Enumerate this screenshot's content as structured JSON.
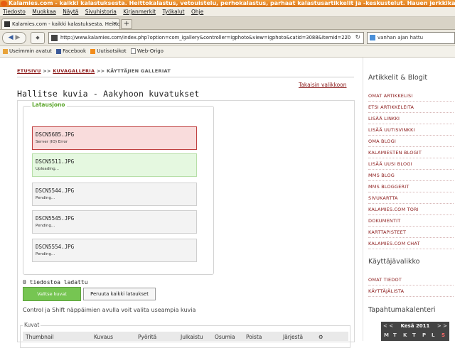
{
  "window": {
    "title": "Kalamies.com - kaikki kalastuksesta. Heittokalastus, vetouistelu, perhokalastus, parhaat kalastusartikkelit ja -keskustelut. Hauen jerkkikalastus, ku..."
  },
  "menubar": [
    "Tiedosto",
    "Muokkaa",
    "Näytä",
    "Sivuhistoria",
    "Kirjanmerkit",
    "Työkalut",
    "Ohje"
  ],
  "tab": {
    "label": "Kalamies.com - kaikki kalastuksesta. Heittoka...",
    "new_tab": "+"
  },
  "nav": {
    "url": "http://www.kalamies.com/index.php?option=com_igallery&controller=igphoto&view=igphoto&catid=3088&Itemid=220",
    "search_value": "vanhan ajan hattu"
  },
  "bookmarks": [
    "Useimmin avatut",
    "Facebook",
    "Uutisotsikot",
    "Web-Origo"
  ],
  "breadcrumb": {
    "home": "ETUSIVU",
    "gallery": "KUVAGALLERIA",
    "current": "KÄYTTÄJIEN GALLERIAT",
    "sep": ">>"
  },
  "back_link": "Takaisin valikkoon",
  "page_title": "Hallitse kuvia - Aakyhoon kuvatukset",
  "upload": {
    "legend": "Latausjono",
    "queue": [
      {
        "file": "DSCN5685.JPG",
        "status": "Server (IO) Error",
        "state": "error"
      },
      {
        "file": "DSCN5511.JPG",
        "status": "Uploading...",
        "state": "uploading"
      },
      {
        "file": "DSCN5544.JPG",
        "status": "Pending...",
        "state": "pending"
      },
      {
        "file": "DSCN5545.JPG",
        "status": "Pending...",
        "state": "pending"
      },
      {
        "file": "DSCN5554.JPG",
        "status": "Pending...",
        "state": "pending"
      }
    ],
    "loaded_count": "0 tiedostoa ladattu",
    "select_button": "Valitse kuvat",
    "cancel_button": "Peruuta kaikki lataukset",
    "hint": "Control ja Shift näppäimien avulla voit valita useampia kuvia"
  },
  "images_table": {
    "legend": "Kuvat",
    "columns": [
      "Thumbnail",
      "Kuvaus",
      "Pyöritä",
      "Julkaistu",
      "Osumia",
      "Poista",
      "Järjestä"
    ]
  },
  "sidebar": {
    "articles_heading": "Artikkelit & Blogit",
    "articles_links": [
      "OMAT ARTIKKELISI",
      "ETSI ARTIKKELEITA",
      "LISÄÄ LINKKI",
      "LISÄÄ UUTISVINKKI",
      "OMA BLOGI",
      "KALAMIESTEN BLOGIT",
      "LISÄÄ UUSI BLOGI",
      "MMS BLOG",
      "MMS BLOGGERIT",
      "SIVUKARTTA",
      "KALAMIES.COM TORI",
      "DOKUMENTIT",
      "KARTTAPISTEET",
      "KALAMIES.COM CHAT"
    ],
    "user_heading": "Käyttäjävalikko",
    "user_links": [
      "OMAT TIEDOT",
      "KÄYTTÄJÄLISTA"
    ],
    "calendar_heading": "Tapahtumakalenteri",
    "calendar": {
      "prev": "< <",
      "month": "Kesä 2011",
      "next": "> >",
      "days": [
        "M",
        "T",
        "K",
        "T",
        "P",
        "L",
        "S"
      ]
    }
  }
}
